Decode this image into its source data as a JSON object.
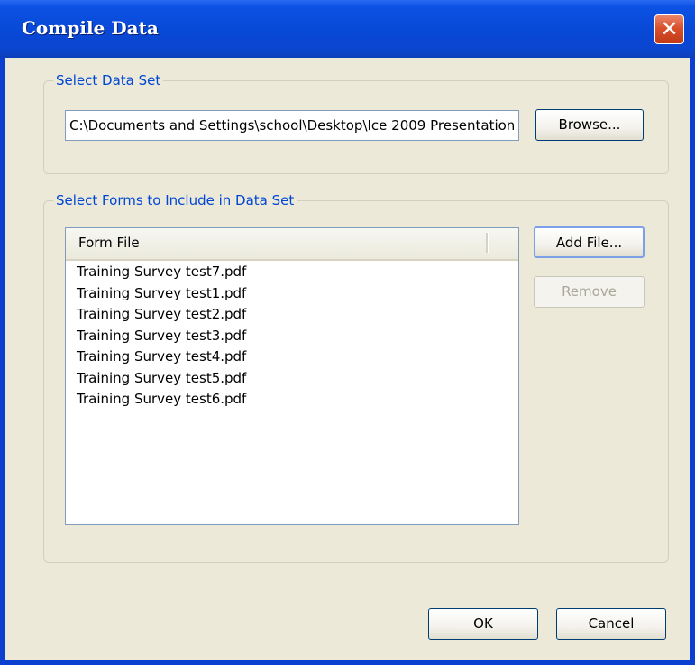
{
  "window": {
    "title": "Compile Data",
    "close_glyph": "✕"
  },
  "data_set": {
    "legend": "Select Data Set",
    "path_value": "C:\\Documents and Settings\\school\\Desktop\\Ice 2009 Presentation",
    "browse_label": "Browse..."
  },
  "forms": {
    "legend": "Select Forms to Include in Data Set",
    "column_header": "Form File",
    "files": [
      "Training Survey test7.pdf",
      "Training Survey test1.pdf",
      "Training Survey test2.pdf",
      "Training Survey test3.pdf",
      "Training Survey test4.pdf",
      "Training Survey test5.pdf",
      "Training Survey test6.pdf"
    ],
    "add_file_label": "Add File...",
    "remove_label": "Remove"
  },
  "footer": {
    "ok_label": "OK",
    "cancel_label": "Cancel"
  },
  "icons": {
    "close": "close-icon"
  },
  "colors": {
    "titlebar": "#0a4fe0",
    "legend_text": "#0046d5",
    "dialog_bg": "#ece9d8",
    "close_button": "#d9502c"
  }
}
